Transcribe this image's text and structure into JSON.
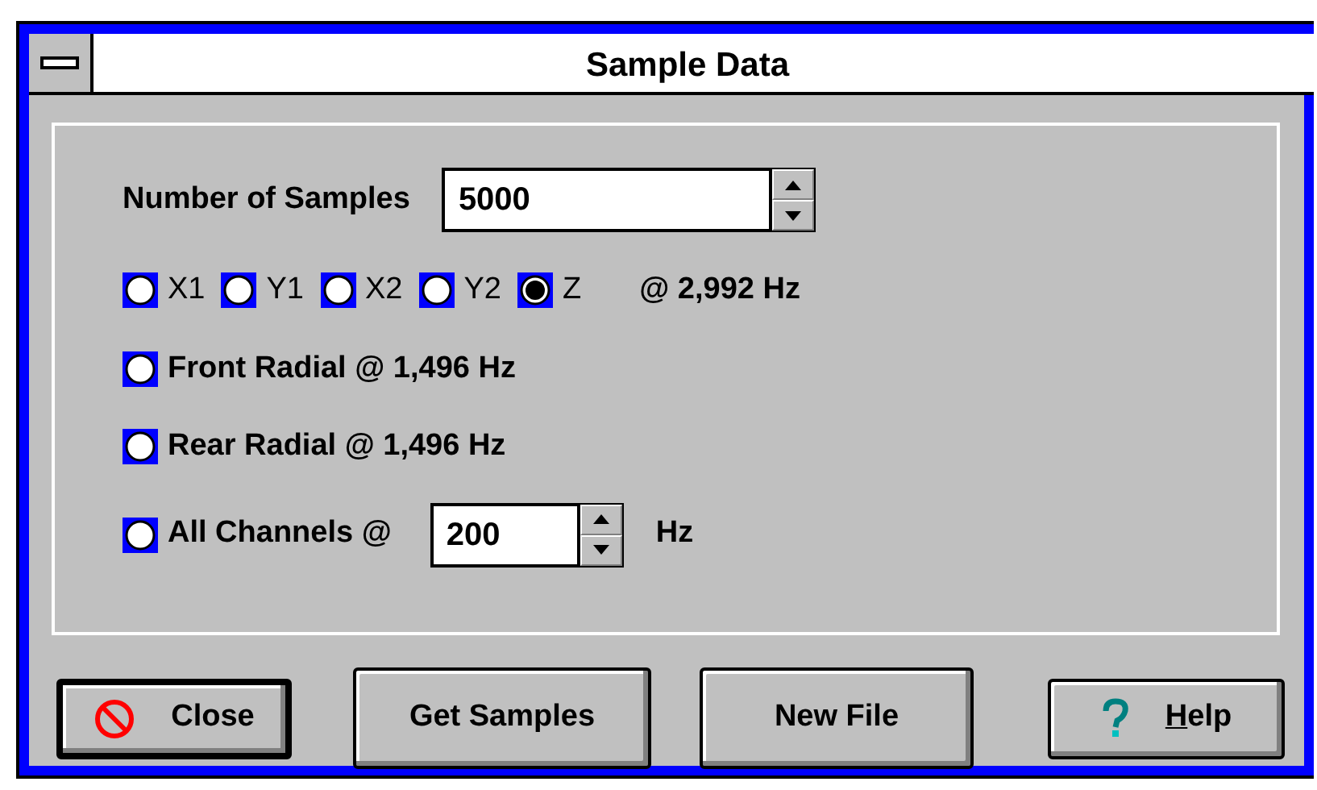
{
  "window": {
    "title": "Sample Data"
  },
  "samples": {
    "label": "Number of Samples",
    "value": "5000"
  },
  "axes": [
    {
      "label": "X1",
      "selected": false
    },
    {
      "label": "Y1",
      "selected": false
    },
    {
      "label": "X2",
      "selected": false
    },
    {
      "label": "Y2",
      "selected": false
    },
    {
      "label": "Z",
      "selected": true
    }
  ],
  "axes_rate": "@ 2,992 Hz",
  "options": [
    {
      "kind": "plain",
      "label": "Front Radial @ 1,496 Hz",
      "selected": false
    },
    {
      "kind": "plain",
      "label": "Rear Radial @ 1,496 Hz",
      "selected": false
    },
    {
      "kind": "rate",
      "label": "All Channels @",
      "value": "200",
      "unit": "Hz",
      "selected": false
    }
  ],
  "buttons": [
    {
      "kind": "close",
      "label": "Close",
      "default": true
    },
    {
      "kind": "plain",
      "label": "Get Samples",
      "default": false
    },
    {
      "kind": "plain",
      "label": "New File",
      "default": false
    },
    {
      "kind": "help",
      "label": "Help",
      "default": false,
      "first_letter_underlined": true
    }
  ]
}
